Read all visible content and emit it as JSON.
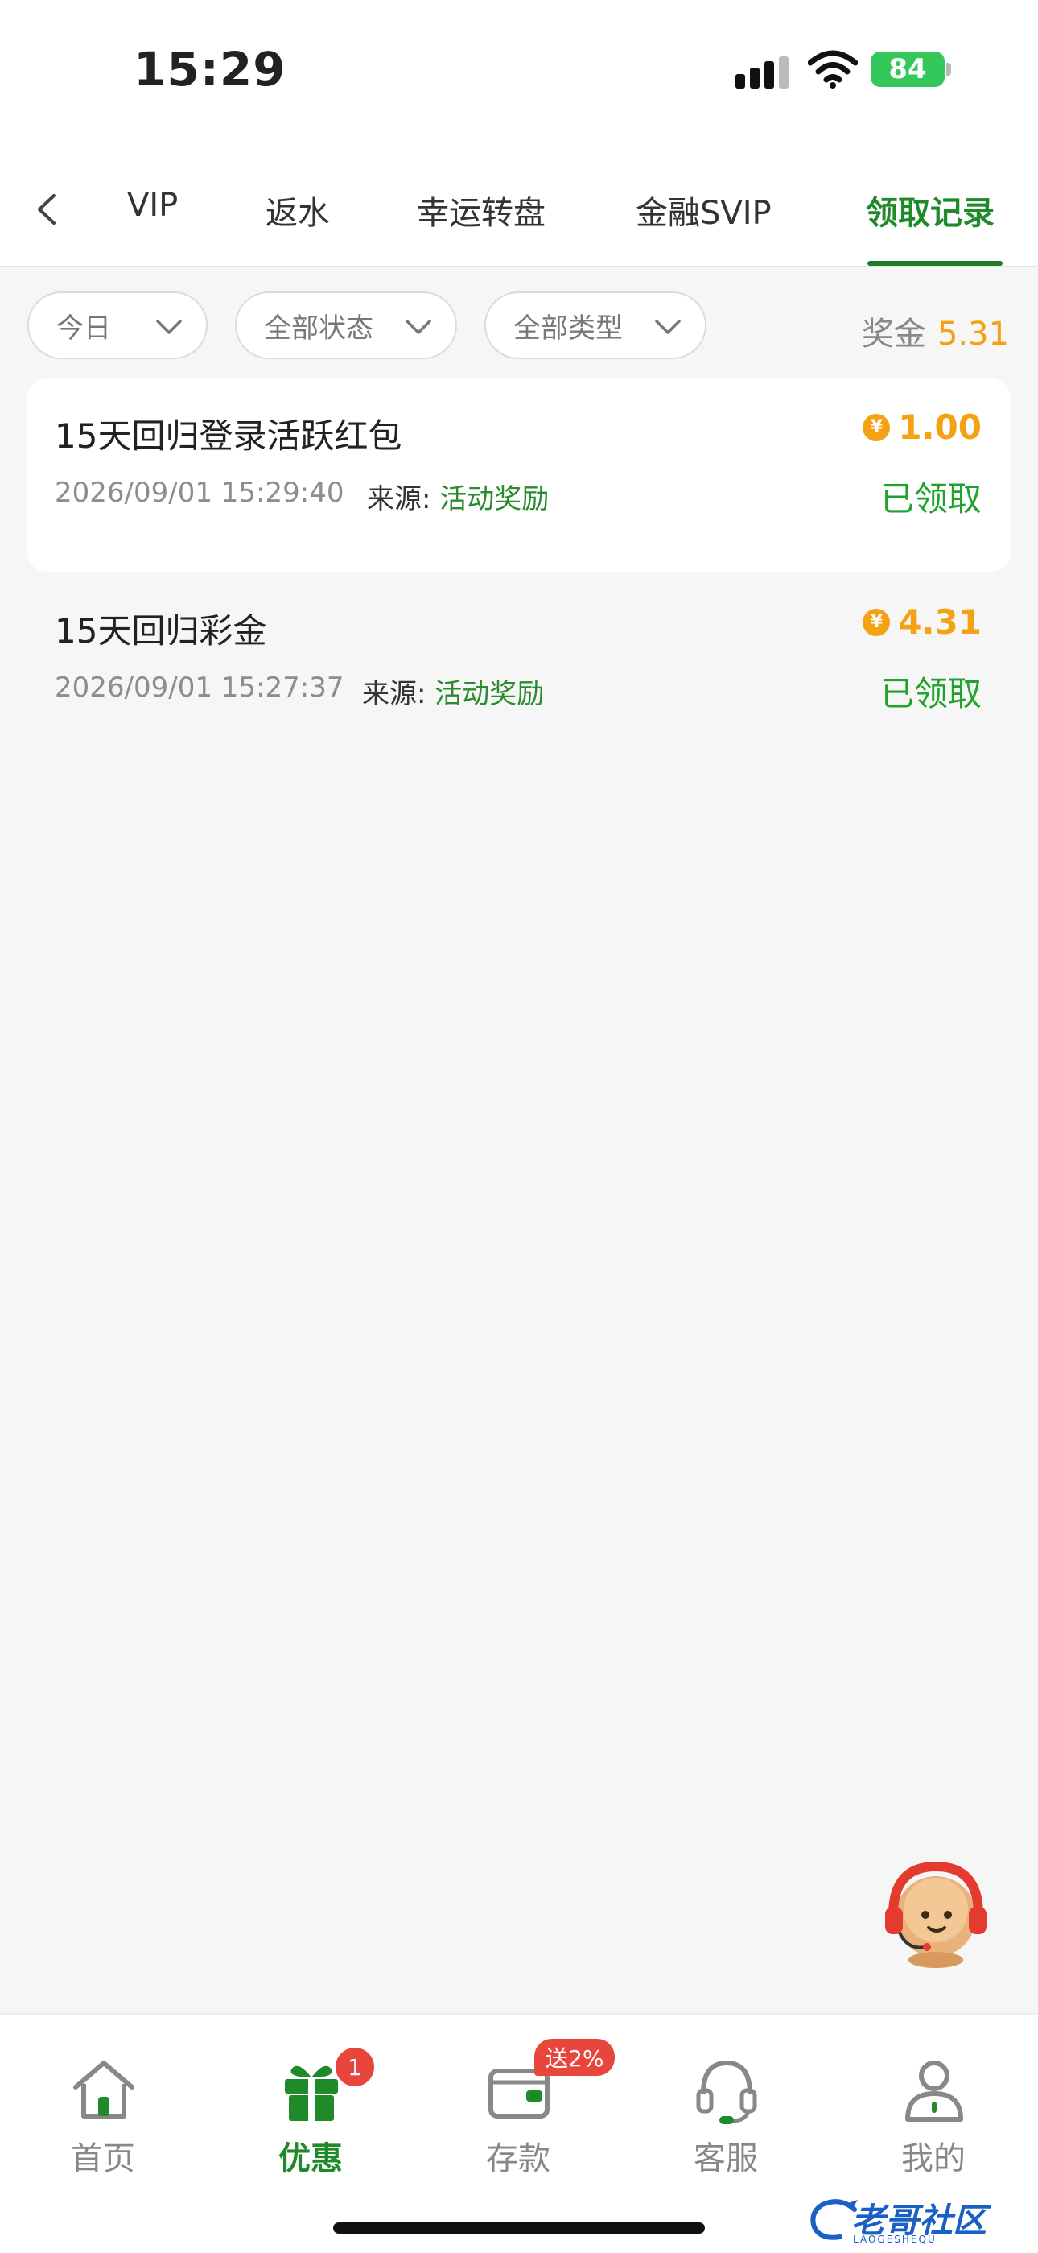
{
  "status_bar": {
    "time": "15:29",
    "battery": "84"
  },
  "tabs": [
    {
      "label": "VIP"
    },
    {
      "label": "返水"
    },
    {
      "label": "幸运转盘"
    },
    {
      "label": "金融SVIP"
    },
    {
      "label": "领取记录",
      "active": true
    }
  ],
  "filters": {
    "date": "今日",
    "status": "全部状态",
    "type": "全部类型",
    "bonus_label": "奖金",
    "bonus_value": "5.31"
  },
  "records": [
    {
      "title": "15天回归登录活跃红包",
      "time": "2026/09/01 15:29:40",
      "source_label": "来源:",
      "source": "活动奖励",
      "amount": "1.00",
      "status": "已领取"
    },
    {
      "title": "15天回归彩金",
      "time": "2026/09/01 15:27:37",
      "source_label": "来源:",
      "source": "活动奖励",
      "amount": "4.31",
      "status": "已领取"
    }
  ],
  "coin_symbol": "¥",
  "tabbar": {
    "items": [
      {
        "label": "首页",
        "icon": "home-icon"
      },
      {
        "label": "优惠",
        "icon": "gift-icon",
        "active": true,
        "badge": "1"
      },
      {
        "label": "存款",
        "icon": "wallet-icon",
        "badge": "送2%"
      },
      {
        "label": "客服",
        "icon": "headset-icon"
      },
      {
        "label": "我的",
        "icon": "user-icon"
      }
    ]
  },
  "watermark": {
    "text": "老哥社区",
    "sub": "LAOGESHEQU"
  },
  "colors": {
    "accent": "#1f8a2a",
    "gold": "#f5a114",
    "badge": "#e8453c"
  }
}
